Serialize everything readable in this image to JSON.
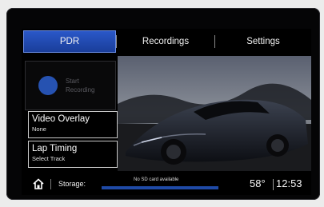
{
  "tabs": [
    {
      "label": "PDR",
      "active": true
    },
    {
      "label": "Recordings",
      "active": false
    },
    {
      "label": "Settings",
      "active": false
    }
  ],
  "record_button": {
    "line1": "Start",
    "line2": "Recording"
  },
  "video_overlay": {
    "title": "Video Overlay",
    "value": "None"
  },
  "lap_timing": {
    "title": "Lap Timing",
    "value": "Select Track"
  },
  "status": {
    "storage_label": "Storage:",
    "sd_message": "No SD card available",
    "temperature": "58°",
    "time": "12:53"
  },
  "colors": {
    "accent": "#2a58c8",
    "storage_bar": "#1f4aa6",
    "record_dot": "#2c5fcf"
  }
}
